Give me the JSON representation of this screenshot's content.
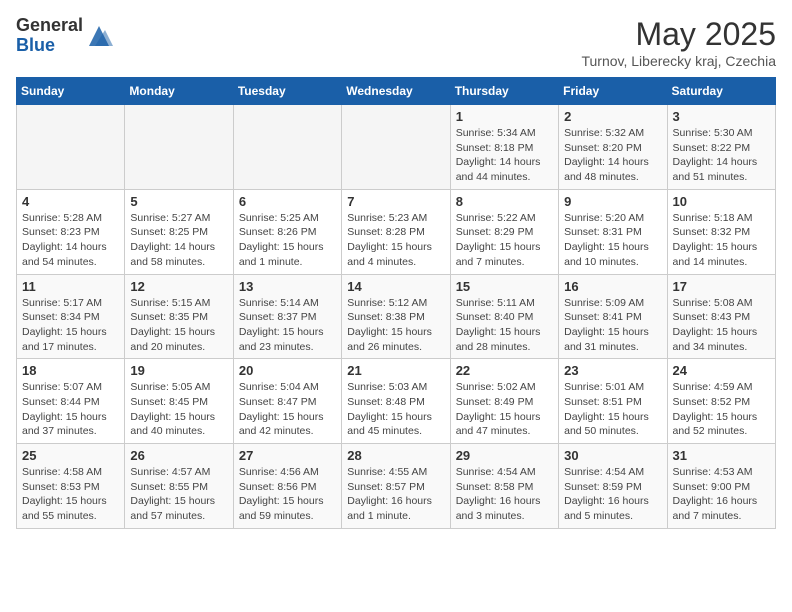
{
  "header": {
    "logo_general": "General",
    "logo_blue": "Blue",
    "month_year": "May 2025",
    "location": "Turnov, Liberecky kraj, Czechia"
  },
  "weekdays": [
    "Sunday",
    "Monday",
    "Tuesday",
    "Wednesday",
    "Thursday",
    "Friday",
    "Saturday"
  ],
  "weeks": [
    [
      {
        "day": "",
        "info": ""
      },
      {
        "day": "",
        "info": ""
      },
      {
        "day": "",
        "info": ""
      },
      {
        "day": "",
        "info": ""
      },
      {
        "day": "1",
        "info": "Sunrise: 5:34 AM\nSunset: 8:18 PM\nDaylight: 14 hours\nand 44 minutes."
      },
      {
        "day": "2",
        "info": "Sunrise: 5:32 AM\nSunset: 8:20 PM\nDaylight: 14 hours\nand 48 minutes."
      },
      {
        "day": "3",
        "info": "Sunrise: 5:30 AM\nSunset: 8:22 PM\nDaylight: 14 hours\nand 51 minutes."
      }
    ],
    [
      {
        "day": "4",
        "info": "Sunrise: 5:28 AM\nSunset: 8:23 PM\nDaylight: 14 hours\nand 54 minutes."
      },
      {
        "day": "5",
        "info": "Sunrise: 5:27 AM\nSunset: 8:25 PM\nDaylight: 14 hours\nand 58 minutes."
      },
      {
        "day": "6",
        "info": "Sunrise: 5:25 AM\nSunset: 8:26 PM\nDaylight: 15 hours\nand 1 minute."
      },
      {
        "day": "7",
        "info": "Sunrise: 5:23 AM\nSunset: 8:28 PM\nDaylight: 15 hours\nand 4 minutes."
      },
      {
        "day": "8",
        "info": "Sunrise: 5:22 AM\nSunset: 8:29 PM\nDaylight: 15 hours\nand 7 minutes."
      },
      {
        "day": "9",
        "info": "Sunrise: 5:20 AM\nSunset: 8:31 PM\nDaylight: 15 hours\nand 10 minutes."
      },
      {
        "day": "10",
        "info": "Sunrise: 5:18 AM\nSunset: 8:32 PM\nDaylight: 15 hours\nand 14 minutes."
      }
    ],
    [
      {
        "day": "11",
        "info": "Sunrise: 5:17 AM\nSunset: 8:34 PM\nDaylight: 15 hours\nand 17 minutes."
      },
      {
        "day": "12",
        "info": "Sunrise: 5:15 AM\nSunset: 8:35 PM\nDaylight: 15 hours\nand 20 minutes."
      },
      {
        "day": "13",
        "info": "Sunrise: 5:14 AM\nSunset: 8:37 PM\nDaylight: 15 hours\nand 23 minutes."
      },
      {
        "day": "14",
        "info": "Sunrise: 5:12 AM\nSunset: 8:38 PM\nDaylight: 15 hours\nand 26 minutes."
      },
      {
        "day": "15",
        "info": "Sunrise: 5:11 AM\nSunset: 8:40 PM\nDaylight: 15 hours\nand 28 minutes."
      },
      {
        "day": "16",
        "info": "Sunrise: 5:09 AM\nSunset: 8:41 PM\nDaylight: 15 hours\nand 31 minutes."
      },
      {
        "day": "17",
        "info": "Sunrise: 5:08 AM\nSunset: 8:43 PM\nDaylight: 15 hours\nand 34 minutes."
      }
    ],
    [
      {
        "day": "18",
        "info": "Sunrise: 5:07 AM\nSunset: 8:44 PM\nDaylight: 15 hours\nand 37 minutes."
      },
      {
        "day": "19",
        "info": "Sunrise: 5:05 AM\nSunset: 8:45 PM\nDaylight: 15 hours\nand 40 minutes."
      },
      {
        "day": "20",
        "info": "Sunrise: 5:04 AM\nSunset: 8:47 PM\nDaylight: 15 hours\nand 42 minutes."
      },
      {
        "day": "21",
        "info": "Sunrise: 5:03 AM\nSunset: 8:48 PM\nDaylight: 15 hours\nand 45 minutes."
      },
      {
        "day": "22",
        "info": "Sunrise: 5:02 AM\nSunset: 8:49 PM\nDaylight: 15 hours\nand 47 minutes."
      },
      {
        "day": "23",
        "info": "Sunrise: 5:01 AM\nSunset: 8:51 PM\nDaylight: 15 hours\nand 50 minutes."
      },
      {
        "day": "24",
        "info": "Sunrise: 4:59 AM\nSunset: 8:52 PM\nDaylight: 15 hours\nand 52 minutes."
      }
    ],
    [
      {
        "day": "25",
        "info": "Sunrise: 4:58 AM\nSunset: 8:53 PM\nDaylight: 15 hours\nand 55 minutes."
      },
      {
        "day": "26",
        "info": "Sunrise: 4:57 AM\nSunset: 8:55 PM\nDaylight: 15 hours\nand 57 minutes."
      },
      {
        "day": "27",
        "info": "Sunrise: 4:56 AM\nSunset: 8:56 PM\nDaylight: 15 hours\nand 59 minutes."
      },
      {
        "day": "28",
        "info": "Sunrise: 4:55 AM\nSunset: 8:57 PM\nDaylight: 16 hours\nand 1 minute."
      },
      {
        "day": "29",
        "info": "Sunrise: 4:54 AM\nSunset: 8:58 PM\nDaylight: 16 hours\nand 3 minutes."
      },
      {
        "day": "30",
        "info": "Sunrise: 4:54 AM\nSunset: 8:59 PM\nDaylight: 16 hours\nand 5 minutes."
      },
      {
        "day": "31",
        "info": "Sunrise: 4:53 AM\nSunset: 9:00 PM\nDaylight: 16 hours\nand 7 minutes."
      }
    ]
  ]
}
